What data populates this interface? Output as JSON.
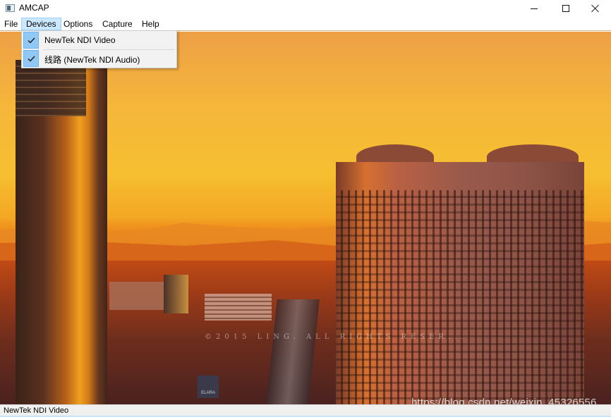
{
  "window": {
    "title": "AMCAP",
    "icon": "app-icon",
    "controls": {
      "minimize": "minimize-icon",
      "maximize": "maximize-icon",
      "close": "close-icon"
    }
  },
  "menubar": {
    "items": [
      {
        "label": "File"
      },
      {
        "label": "Devices",
        "active": true
      },
      {
        "label": "Options"
      },
      {
        "label": "Capture"
      },
      {
        "label": "Help"
      }
    ]
  },
  "devices_menu": {
    "items": [
      {
        "label": "NewTek NDI Video",
        "checked": true
      },
      {
        "label": "线路 (NewTek NDI Audio)",
        "checked": true
      }
    ]
  },
  "video": {
    "description": "Sunset cityscape video preview",
    "overlay_copyright": "©2015 LING. ALL RIGHTS RESER...",
    "sign_text": "ELARA"
  },
  "watermark": "https://blog.csdn.net/weixin_45326556",
  "statusbar": {
    "text": "NewTek NDI Video"
  },
  "colors": {
    "menu_highlight": "#cce8ff",
    "check_background": "#90c8f6",
    "sky_top": "#eda046",
    "sky_mid": "#f6bf31"
  }
}
